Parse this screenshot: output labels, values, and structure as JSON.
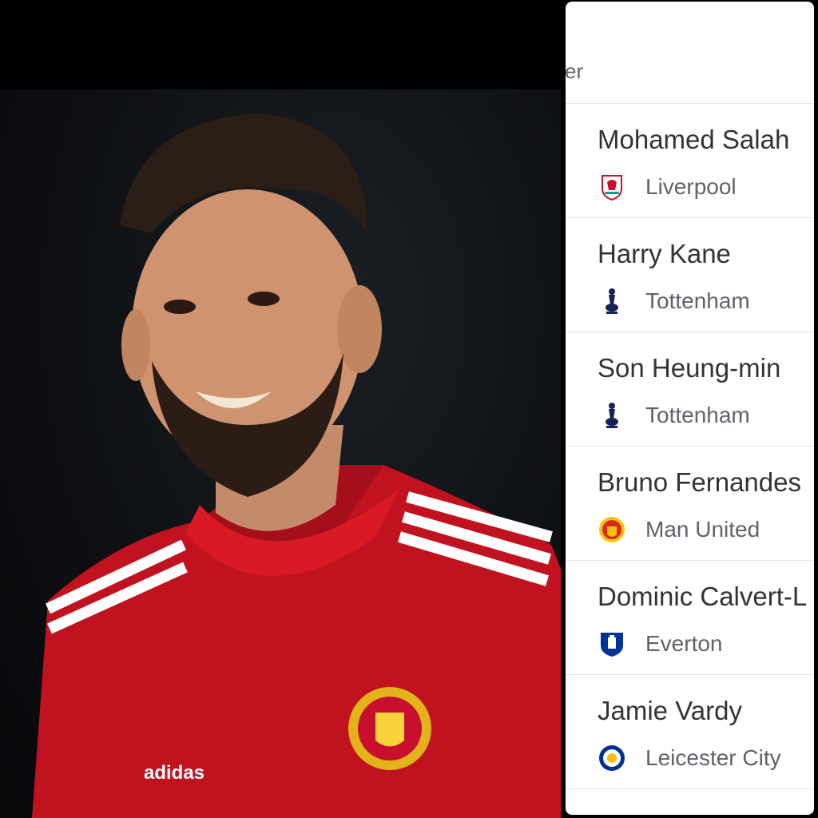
{
  "header": {
    "label": "yer"
  },
  "players": [
    {
      "name": "Mohamed Salah",
      "club": "Liverpool",
      "crest_icon": "liverpool-crest-icon",
      "crest_color": "#c8102e"
    },
    {
      "name": "Harry Kane",
      "club": "Tottenham",
      "crest_icon": "tottenham-crest-icon",
      "crest_color": "#132257"
    },
    {
      "name": "Son Heung-min",
      "club": "Tottenham",
      "crest_icon": "tottenham-crest-icon",
      "crest_color": "#132257"
    },
    {
      "name": "Bruno Fernandes",
      "club": "Man United",
      "crest_icon": "man-united-crest-icon",
      "crest_color": "#da291c"
    },
    {
      "name": "Dominic Calvert-L",
      "club": "Everton",
      "crest_icon": "everton-crest-icon",
      "crest_color": "#003399"
    },
    {
      "name": "Jamie Vardy",
      "club": "Leicester City",
      "crest_icon": "leicester-crest-icon",
      "crest_color": "#003090"
    }
  ],
  "photo": {
    "shirt_brand": "adidas",
    "jersey_color": "#c8102e"
  }
}
